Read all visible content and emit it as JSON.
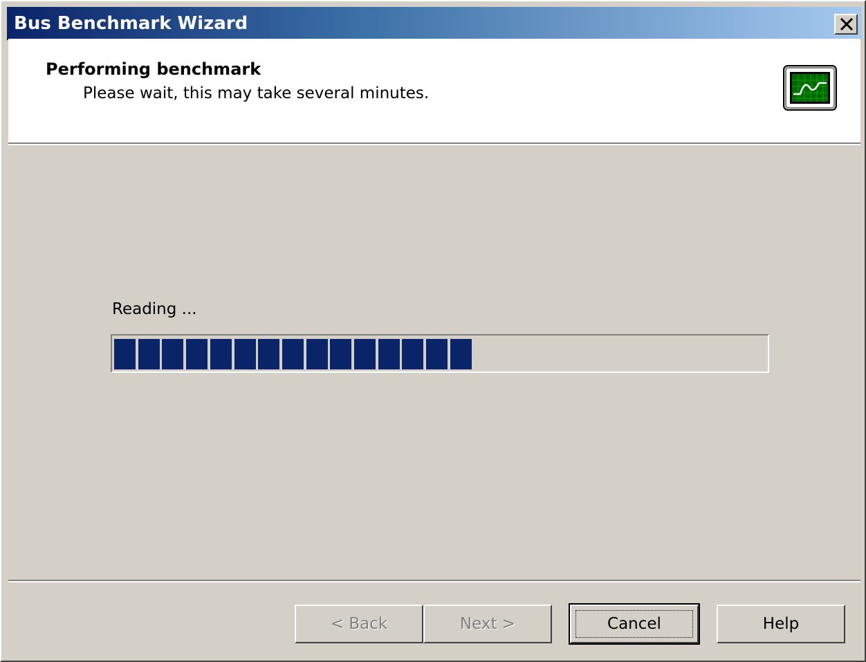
{
  "window": {
    "title": "Bus Benchmark Wizard",
    "close_icon": "close-icon"
  },
  "header": {
    "title": "Performing benchmark",
    "subtitle": "Please wait, this may take several minutes.",
    "icon": "monitor-waveform-icon"
  },
  "progress": {
    "status_label": "Reading ...",
    "fraction": 0.55,
    "filled_blocks": 15,
    "bar_color": "#0a246a"
  },
  "buttons": {
    "back": "< Back",
    "next": "Next >",
    "cancel": "Cancel",
    "help": "Help"
  },
  "colors": {
    "title_gradient_start": "#0a246a",
    "title_gradient_end": "#a6caf0",
    "dialog_bg": "#d4d0c8",
    "header_bg": "#ffffff"
  }
}
